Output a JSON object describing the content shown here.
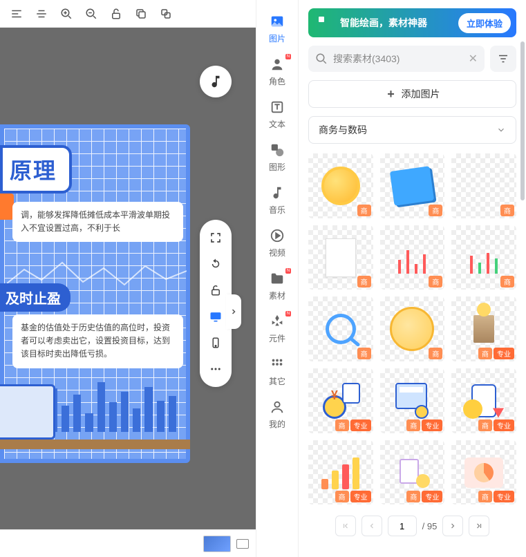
{
  "toolbar": {
    "icons": [
      "align-left",
      "align-center",
      "zoom-in",
      "zoom-out",
      "unlock",
      "copy",
      "layers"
    ]
  },
  "nav": {
    "items": [
      {
        "label": "图片",
        "icon": "image-icon",
        "active": true
      },
      {
        "label": "角色",
        "icon": "avatar-icon",
        "badge": "N"
      },
      {
        "label": "文本",
        "icon": "text-icon"
      },
      {
        "label": "图形",
        "icon": "shape-icon"
      },
      {
        "label": "音乐",
        "icon": "music-icon"
      },
      {
        "label": "视频",
        "icon": "video-icon"
      },
      {
        "label": "素材",
        "icon": "folder-icon",
        "badge": "N"
      },
      {
        "label": "元件",
        "icon": "component-icon",
        "badge": "N"
      },
      {
        "label": "其它",
        "icon": "more-icon"
      },
      {
        "label": "我的",
        "icon": "user-icon"
      }
    ]
  },
  "promo": {
    "text": "智能绘画，素材神器",
    "button": "立即体验"
  },
  "search": {
    "placeholder": "搜索素材(3403)"
  },
  "add_button": "添加图片",
  "category": {
    "selected": "商务与数码"
  },
  "tags": {
    "biz": "商",
    "pro": "专业"
  },
  "assets": [
    {
      "name": "gold-coin",
      "tags": [
        "biz"
      ]
    },
    {
      "name": "blue-sticky-note",
      "tags": [
        "biz"
      ]
    },
    {
      "name": "blank-transparent",
      "tags": [
        "biz"
      ]
    },
    {
      "name": "white-paper",
      "tags": [
        "biz"
      ]
    },
    {
      "name": "candlestick-red",
      "tags": [
        "biz"
      ]
    },
    {
      "name": "candlestick-mixed",
      "tags": [
        "biz"
      ]
    },
    {
      "name": "magnifying-glass",
      "tags": [
        "biz"
      ]
    },
    {
      "name": "gold-coin-flat",
      "tags": [
        "biz"
      ]
    },
    {
      "name": "trophy-pedestal",
      "tags": [
        "biz",
        "pro"
      ]
    },
    {
      "name": "money-bag-coins",
      "tags": [
        "biz",
        "pro"
      ]
    },
    {
      "name": "calculator-iso",
      "tags": [
        "biz",
        "pro"
      ]
    },
    {
      "name": "scroll-coin-arrow",
      "tags": [
        "biz",
        "pro"
      ]
    },
    {
      "name": "bar-chart-rising",
      "tags": [
        "biz",
        "pro"
      ]
    },
    {
      "name": "documents-stack",
      "tags": [
        "biz",
        "pro"
      ]
    },
    {
      "name": "pie-chart-panel",
      "tags": [
        "biz",
        "pro"
      ]
    }
  ],
  "pagination": {
    "current": "1",
    "total": "/ 95"
  },
  "artboard": {
    "title": "原理",
    "section1_text": "调，能够发挥降低摊低成本平滑波单期投入不宜设置过高，不利于长",
    "section2_label": "及时止盈",
    "section2_text": "基金的估值处于历史估值的高位时，投资者可以考虑卖出它，设置投资目标，达到该目标时卖出降低亏损。"
  }
}
